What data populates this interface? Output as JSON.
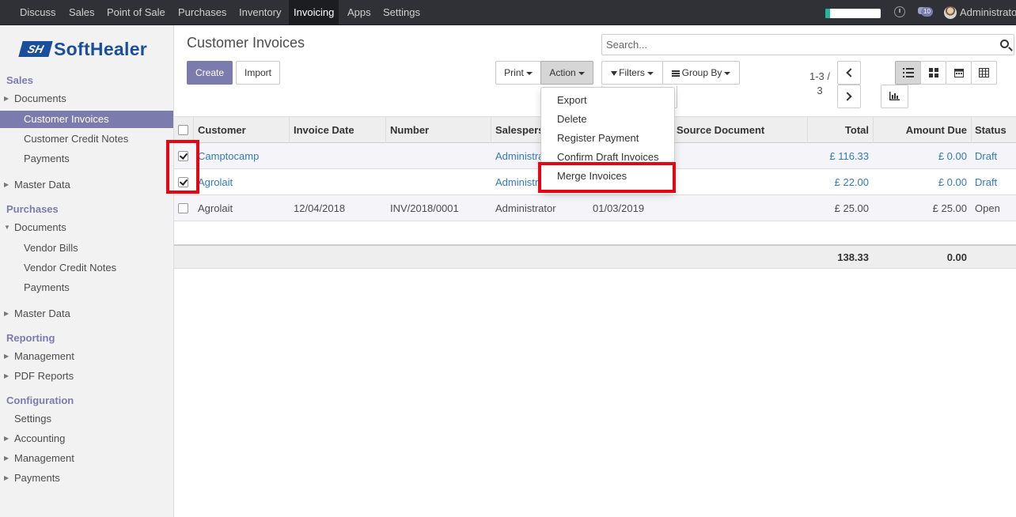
{
  "topbar": {
    "menu": [
      "Discuss",
      "Sales",
      "Point of Sale",
      "Purchases",
      "Inventory",
      "Invoicing",
      "Apps",
      "Settings"
    ],
    "active": "Invoicing",
    "chat_count": "10",
    "user_name": "Administrator",
    "loading_progress": 0.08
  },
  "logo": {
    "mark": "SH",
    "text": "SoftHealer"
  },
  "sidebar": {
    "sales": {
      "title": "Sales",
      "documents": "Documents",
      "customer_invoices": "Customer Invoices",
      "customer_credit_notes": "Customer Credit Notes",
      "payments": "Payments",
      "master_data": "Master Data"
    },
    "purchases": {
      "title": "Purchases",
      "documents": "Documents",
      "vendor_bills": "Vendor Bills",
      "vendor_credit_notes": "Vendor Credit Notes",
      "payments": "Payments",
      "master_data": "Master Data"
    },
    "reporting": {
      "title": "Reporting",
      "management": "Management",
      "pdf_reports": "PDF Reports"
    },
    "configuration": {
      "title": "Configuration",
      "settings": "Settings",
      "accounting": "Accounting",
      "management": "Management",
      "payments": "Payments"
    }
  },
  "control": {
    "title": "Customer Invoices",
    "search_placeholder": "Search...",
    "create": "Create",
    "import": "Import",
    "print": "Print",
    "action": "Action",
    "filters": "Filters",
    "group_by": "Group By",
    "pager_range": "1-3 /",
    "pager_total": "3"
  },
  "action_menu": [
    "Export",
    "Delete",
    "Register Payment",
    "Confirm Draft Invoices",
    "Merge Invoices"
  ],
  "table": {
    "headers": {
      "customer": "Customer",
      "invoice_date": "Invoice Date",
      "number": "Number",
      "salesperson": "Salesperson",
      "due_date": "",
      "source_document": "Source Document",
      "total": "Total",
      "amount_due": "Amount Due",
      "status": "Status"
    },
    "rows": [
      {
        "customer": "Camptocamp",
        "invoice_date": "",
        "number": "",
        "salesperson": "Administrator",
        "due_date": "",
        "source_document": "",
        "total": "£ 116.33",
        "amount_due": "£ 0.00",
        "status": "Draft",
        "checked": true
      },
      {
        "customer": "Agrolait",
        "invoice_date": "",
        "number": "",
        "salesperson": "Administrator",
        "due_date": "",
        "source_document": "",
        "total": "£ 22.00",
        "amount_due": "£ 0.00",
        "status": "Draft",
        "checked": true
      },
      {
        "customer": "Agrolait",
        "invoice_date": "12/04/2018",
        "number": "INV/2018/0001",
        "salesperson": "Administrator",
        "due_date": "01/03/2019",
        "source_document": "",
        "total": "£ 25.00",
        "amount_due": "£ 25.00",
        "status": "Open",
        "checked": false
      }
    ],
    "footer": {
      "total": "138.33",
      "amount_due": "0.00"
    }
  },
  "colors": {
    "brand": "#7c7bad",
    "link": "#337ab7",
    "highlight": "#e30613",
    "logo": "#1b4f9c"
  }
}
